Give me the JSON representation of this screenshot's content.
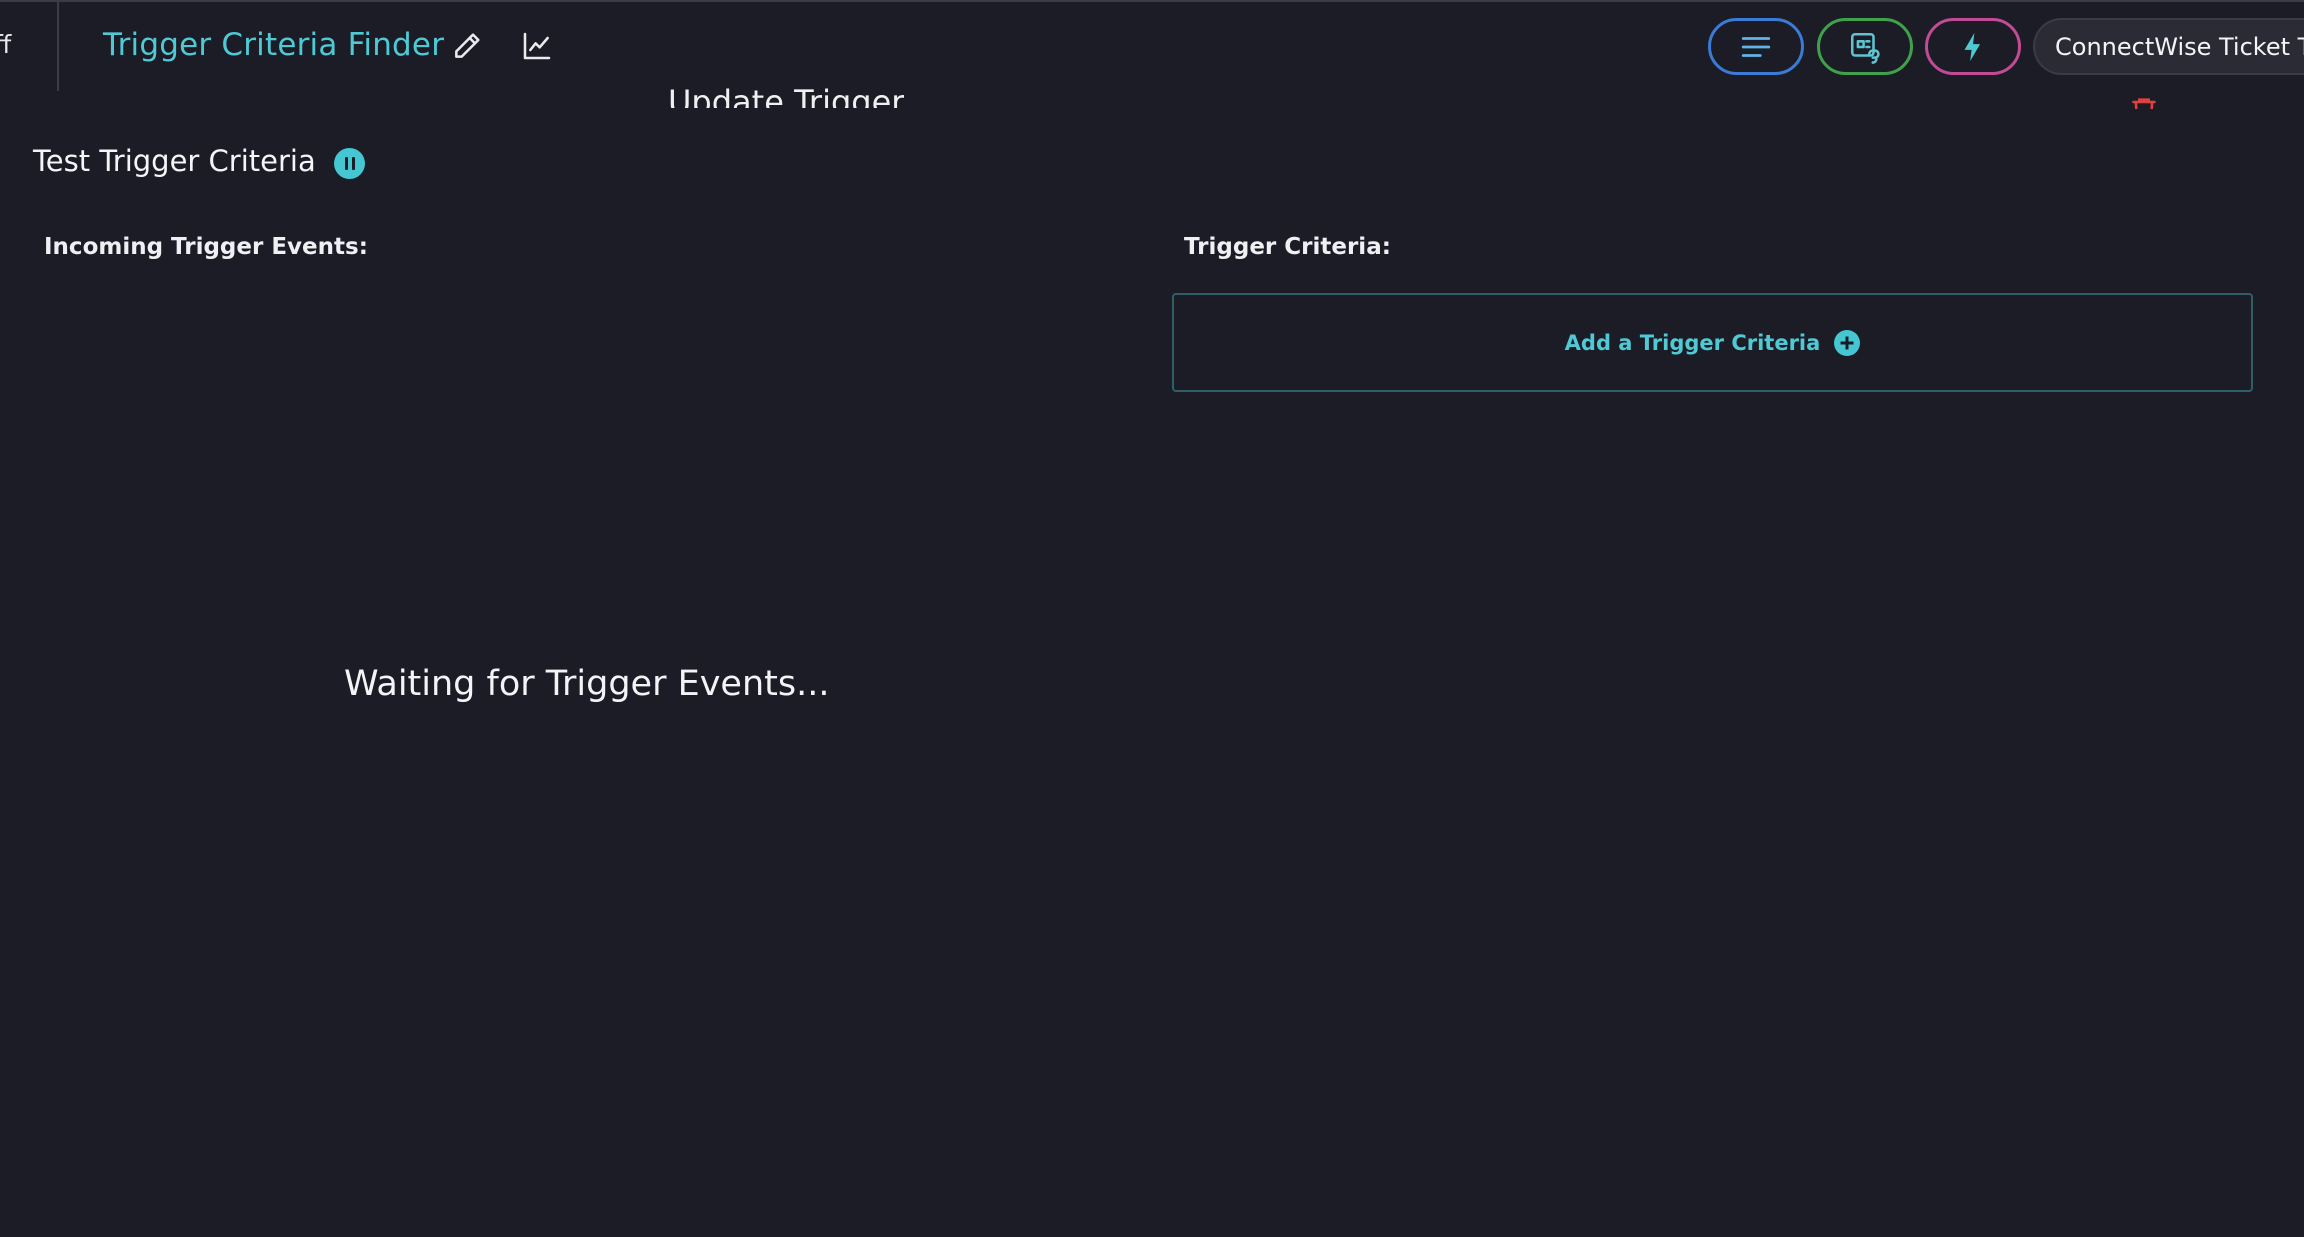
{
  "topbar": {
    "left_fragment": "ff",
    "title": "Trigger Criteria Finder",
    "edit_icon": "pencil-icon",
    "stats_icon": "line-chart-icon",
    "actions": [
      {
        "name": "details",
        "icon": "text-lines-icon",
        "color": "#3a7bd6"
      },
      {
        "name": "integration",
        "icon": "linked-card-icon",
        "color": "#3fa24b"
      },
      {
        "name": "triggers",
        "icon": "lightning-icon",
        "color": "#c34a94"
      }
    ],
    "selector_value": "ConnectWise Ticket T"
  },
  "behind_modal": {
    "title": "Update Trigger",
    "delete_icon": "trash-icon",
    "delete_color": "#e0413f"
  },
  "main": {
    "title": "Test Trigger Criteria",
    "pause_icon": "pause-icon",
    "incoming_label": "Incoming Trigger Events:",
    "criteria_label": "Trigger Criteria:",
    "add_criteria_label": "Add a Trigger Criteria",
    "add_icon": "plus-circle-icon",
    "waiting_text": "Waiting for Trigger Events..."
  },
  "colors": {
    "background": "#1b1c26",
    "accent": "#4fc9d4",
    "border": "#2f5e66"
  }
}
